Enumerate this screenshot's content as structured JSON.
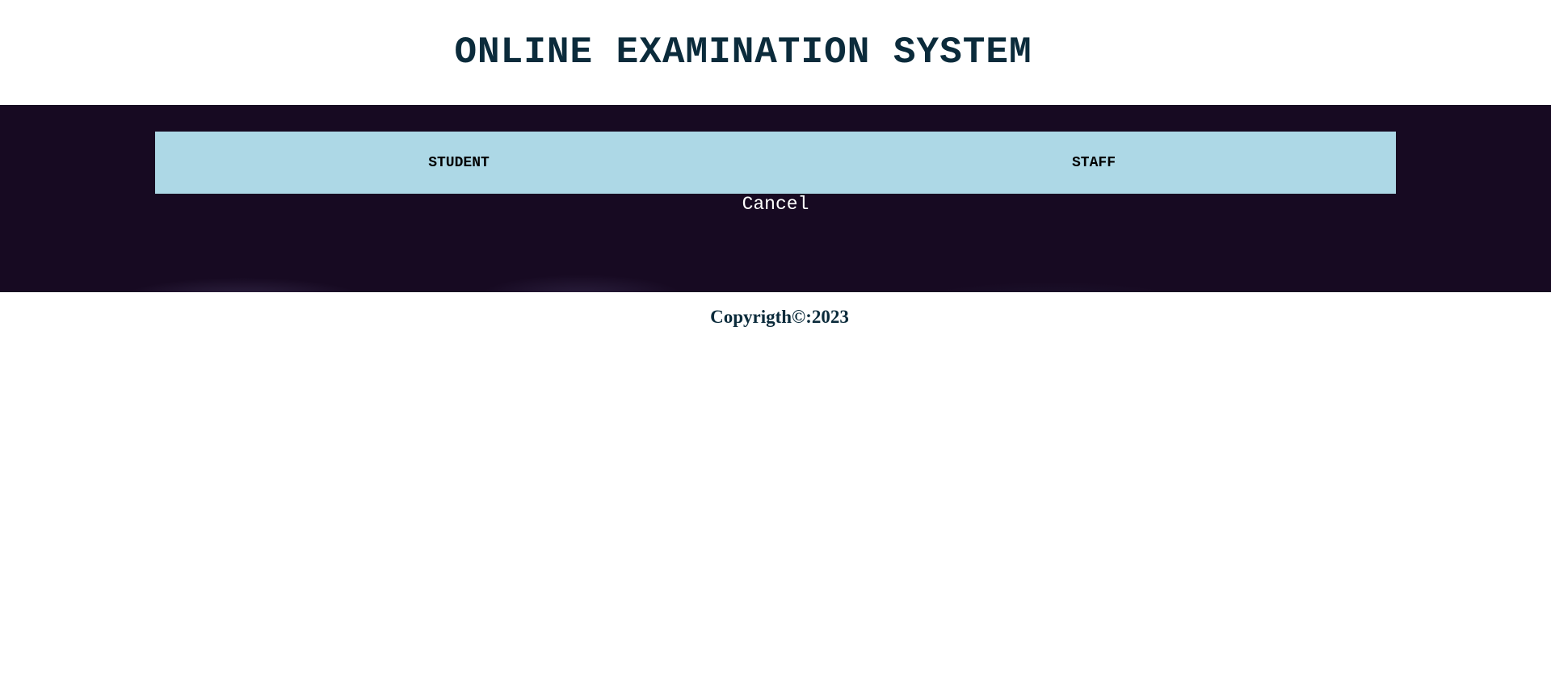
{
  "header": {
    "title": "ONLINE EXAMINATION SYSTEM"
  },
  "roles": {
    "student_label": "STUDENT",
    "staff_label": "STAFF"
  },
  "actions": {
    "cancel_label": "Cancel"
  },
  "footer": {
    "copyright": "Copyrigth©:2023"
  },
  "colors": {
    "title_text": "#0b2b3b",
    "banner_background": "#170a22",
    "role_bar_background": "#add8e6",
    "cancel_text": "#ffffff"
  }
}
